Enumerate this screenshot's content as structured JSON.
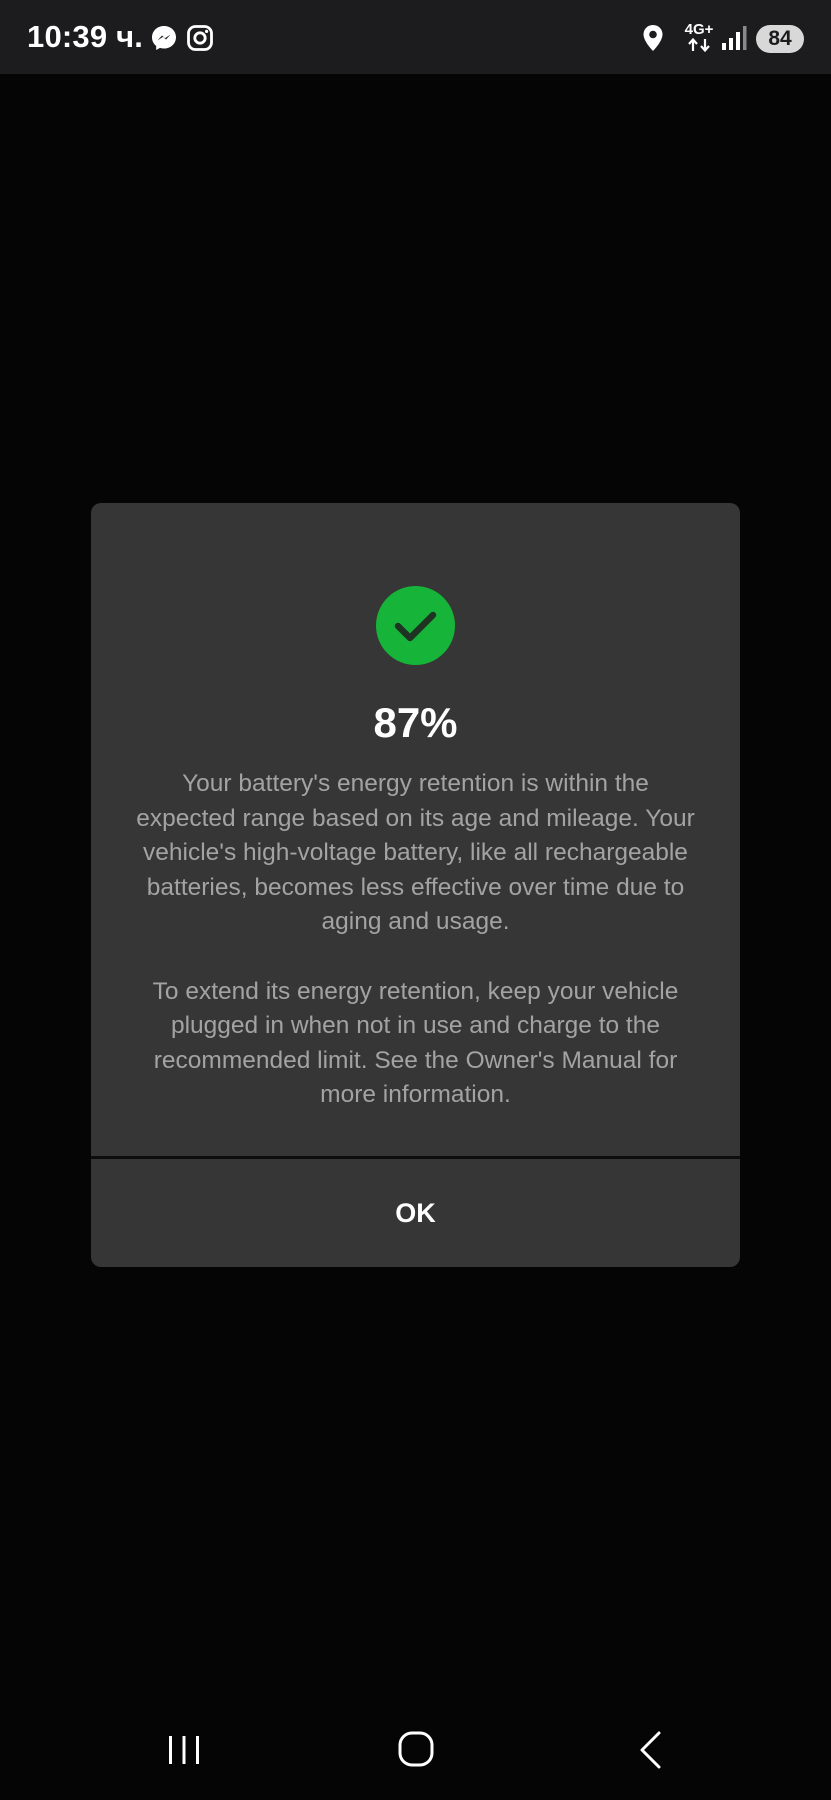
{
  "status_bar": {
    "time": "10:39 ч.",
    "network": "4G+",
    "battery": "84",
    "icons": [
      "messenger-icon",
      "instagram-icon",
      "location-icon",
      "data-transfer-icon",
      "signal-icon"
    ]
  },
  "dialog": {
    "icon": "check-circle-icon",
    "title": "87%",
    "body_paragraph_1": "Your battery's energy retention is within the expected range based on its age and mileage. Your vehicle's high-voltage battery, like all rechargeable batteries, becomes less effective over time due to aging and usage.",
    "body_paragraph_2": "To extend its energy retention, keep your vehicle plugged in when not in use and charge to the recommended limit. See the Owner's Manual for more information.",
    "ok_label": "OK"
  },
  "nav_bar": {
    "icons": [
      "recent-apps-icon",
      "home-icon",
      "back-icon"
    ]
  },
  "colors": {
    "status_bar_bg": "#1c1c1e",
    "background": "#050505",
    "dialog_bg": "#363636",
    "accent_green": "#16b53a",
    "body_text": "#a3a3a3"
  }
}
